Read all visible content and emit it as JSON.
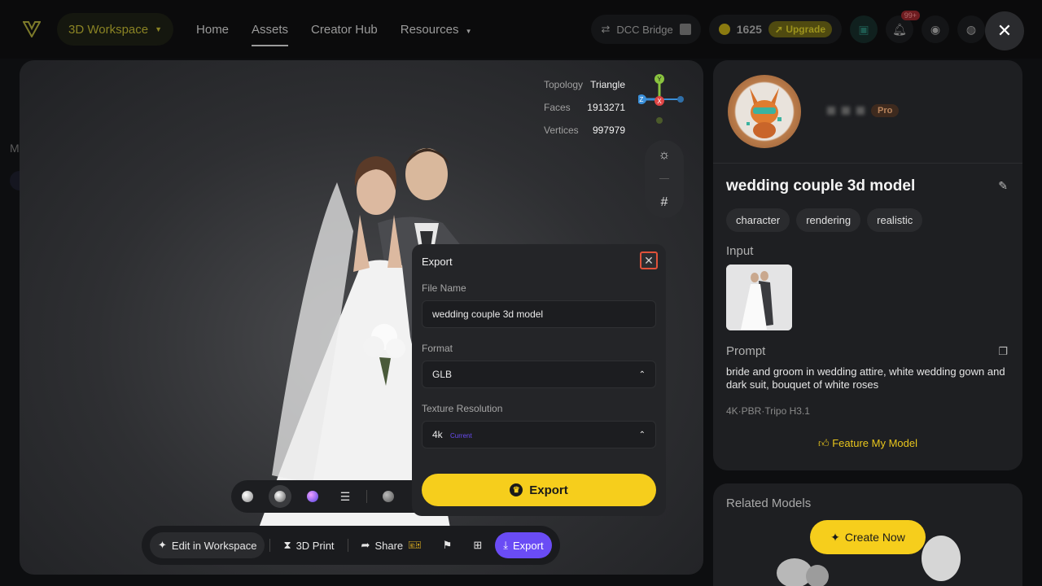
{
  "nav": {
    "workspace": "3D Workspace",
    "links": [
      "Home",
      "Assets",
      "Creator Hub",
      "Resources"
    ],
    "active_link": "Assets",
    "dcc_bridge": "DCC Bridge",
    "credits": "1625",
    "upgrade": "Upgrade",
    "notifications_badge": "99+",
    "close_label": "✕"
  },
  "background": {
    "partial_text": "M"
  },
  "viewer": {
    "stats": [
      {
        "label": "Topology",
        "value": "Triangle"
      },
      {
        "label": "Faces",
        "value": "1913271"
      },
      {
        "label": "Vertices",
        "value": "997979"
      }
    ],
    "axes": {
      "y": "Y",
      "z": "Z",
      "x": "X"
    },
    "render_modes": [
      "clay-sphere",
      "matcap-sphere",
      "normal-sphere",
      "settings",
      "gray-sphere",
      "gold-sphere"
    ],
    "actions": {
      "edit": "Edit in Workspace",
      "print": "3D Print",
      "share": "Share",
      "export": "Export"
    }
  },
  "export_modal": {
    "title": "Export",
    "file_name_label": "File Name",
    "file_name": "wedding couple 3d model",
    "format_label": "Format",
    "format": "GLB",
    "texture_label": "Texture Resolution",
    "texture": "4k",
    "texture_note": "Current",
    "export_button": "Export"
  },
  "detail": {
    "badge": "Pro",
    "title": "wedding couple 3d model",
    "tags": [
      "character",
      "rendering",
      "realistic"
    ],
    "input_label": "Input",
    "prompt_label": "Prompt",
    "prompt": "bride and groom in wedding attire, white wedding gown and dark suit, bouquet of white roses",
    "meta": "4K·PBR·Tripo H3.1",
    "feature": "Feature My Model"
  },
  "related": {
    "title": "Related Models",
    "create_now": "Create Now"
  },
  "colors": {
    "accent_yellow": "#f6ce1c",
    "accent_purple": "#6a4cf5",
    "close_outline": "#e0523a"
  }
}
